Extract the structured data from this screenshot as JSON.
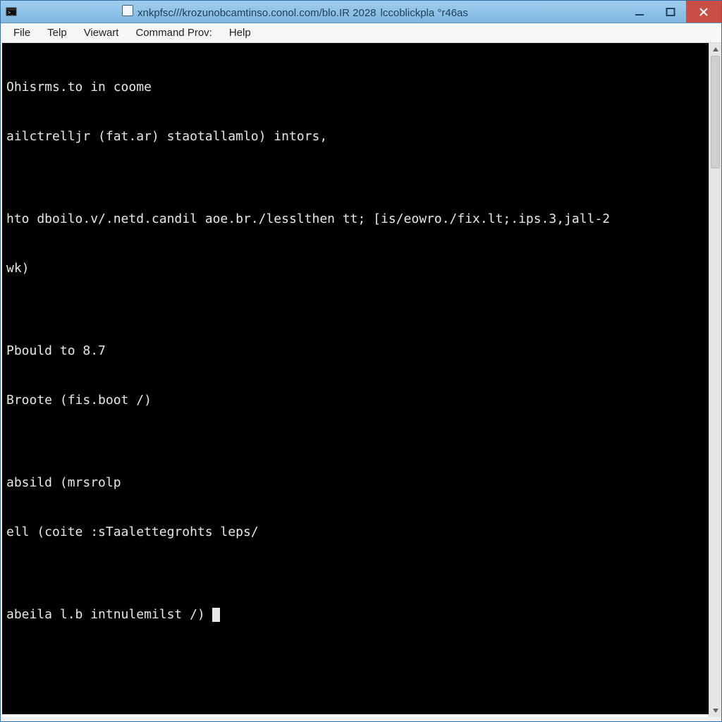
{
  "titlebar": {
    "title_prefix": "xnkpfsc///krozunobcamtinso.conol.com/blo.IR  2028",
    "title_suffix": "lccoblickpla  °r46as",
    "controls": {
      "minimize_aria": "Minimize",
      "maximize_aria": "Maximize",
      "close_aria": "Close"
    }
  },
  "menubar": {
    "items": [
      {
        "label": "File"
      },
      {
        "label": "Telp"
      },
      {
        "label": "Viewart"
      },
      {
        "label": "Command Prov:"
      },
      {
        "label": "Help"
      }
    ]
  },
  "terminal": {
    "lines": [
      "Ohisrms.to in coome",
      "ailctrelljr (fat.ar) staotallamlo) intors,",
      "",
      "hto dboilo.v/.netd.candil aoe.br./lesslthen tt; [is/eowro./fix.lt;.ips.3,jall-2",
      "wk)",
      "",
      "Pbould to 8.7",
      "Broote (fis.boot /)",
      "",
      "absild (mrsrolp",
      "ell (coite :sTaalettegrohts leps/",
      ""
    ],
    "prompt": "abeila l.b intnulemilst /)"
  },
  "scrollbar": {
    "up_aria": "Scroll up",
    "down_aria": "Scroll down",
    "thumb_aria": "Scroll thumb"
  }
}
